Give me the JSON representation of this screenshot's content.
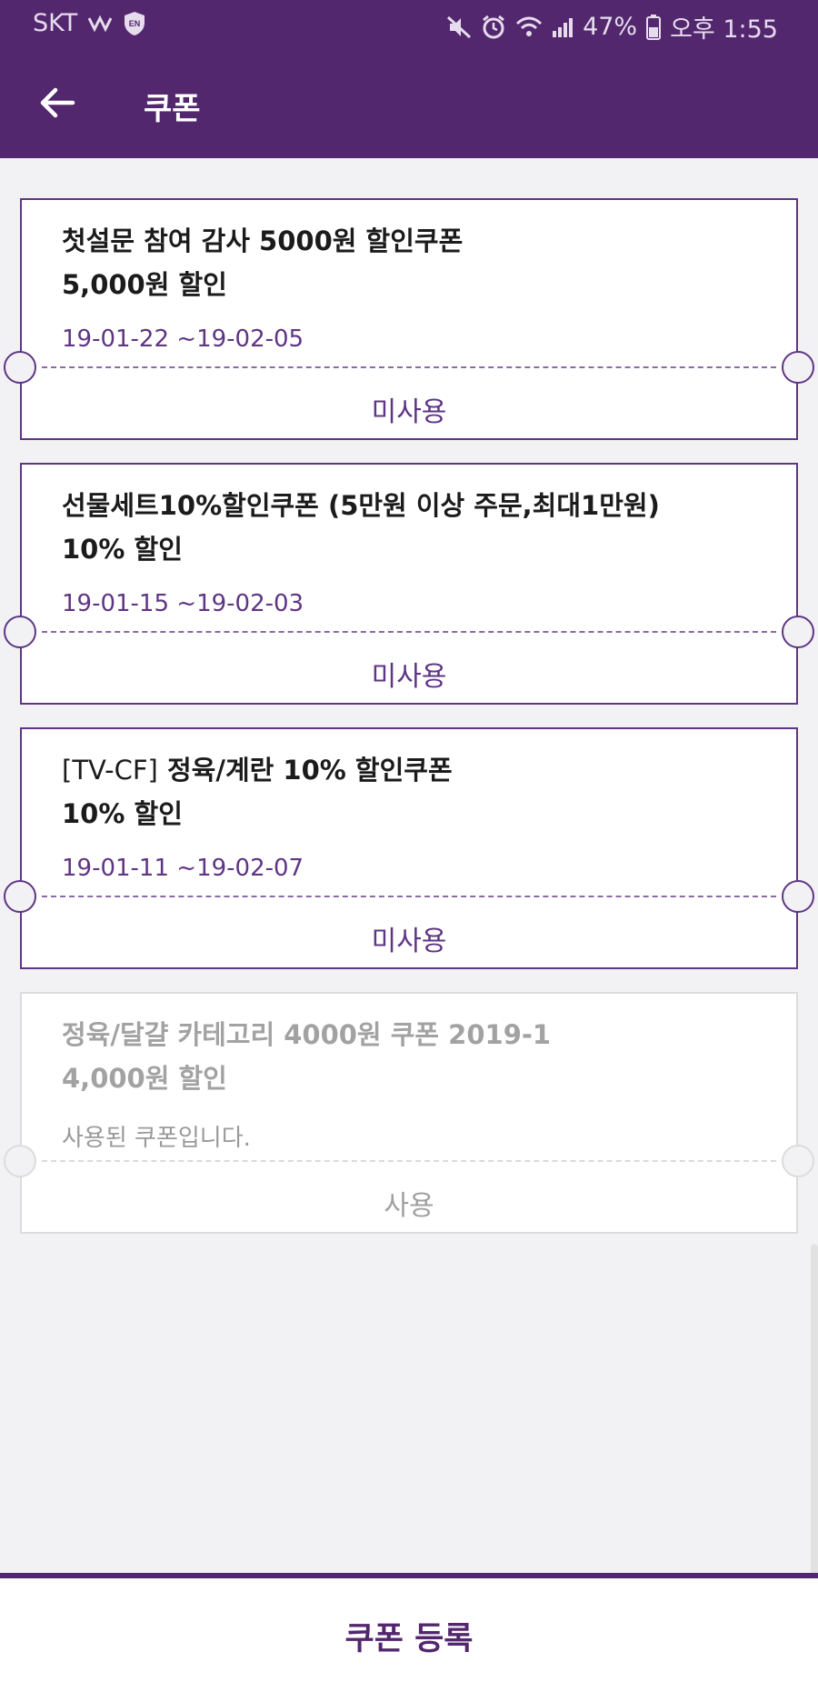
{
  "status_bar": {
    "carrier": "SKT",
    "battery": "47%",
    "time": "오후 1:55"
  },
  "header": {
    "title": "쿠폰",
    "back_icon": "arrow-left-icon"
  },
  "coupons": [
    {
      "title_bold": "첫설문 참여 감사 5000원 할인쿠폰",
      "discount": "5,000원 할인",
      "date": "19-01-22 ~19-02-05",
      "status": "미사용"
    },
    {
      "title_bold": "선물세트10%할인쿠폰 (5만원 이상 주문,최대1만원)",
      "discount": "10% 할인",
      "date": "19-01-15 ~19-02-03",
      "status": "미사용"
    },
    {
      "title_prefix": "[TV-CF]",
      "title_bold": "정육/계란 10% 할인쿠폰",
      "discount": "10% 할인",
      "date": "19-01-11 ~19-02-07",
      "status": "미사용"
    },
    {
      "title_bold": "정육/달걀 카테고리 4000원 쿠폰 2019-1",
      "discount": "4,000원 할인",
      "date": "사용된 쿠폰입니다.",
      "status": "사용"
    }
  ],
  "footer": {
    "register_label": "쿠폰 등록"
  },
  "colors": {
    "brand": "#53276d",
    "accent": "#5f3584",
    "used_text": "#a0a0a0"
  }
}
